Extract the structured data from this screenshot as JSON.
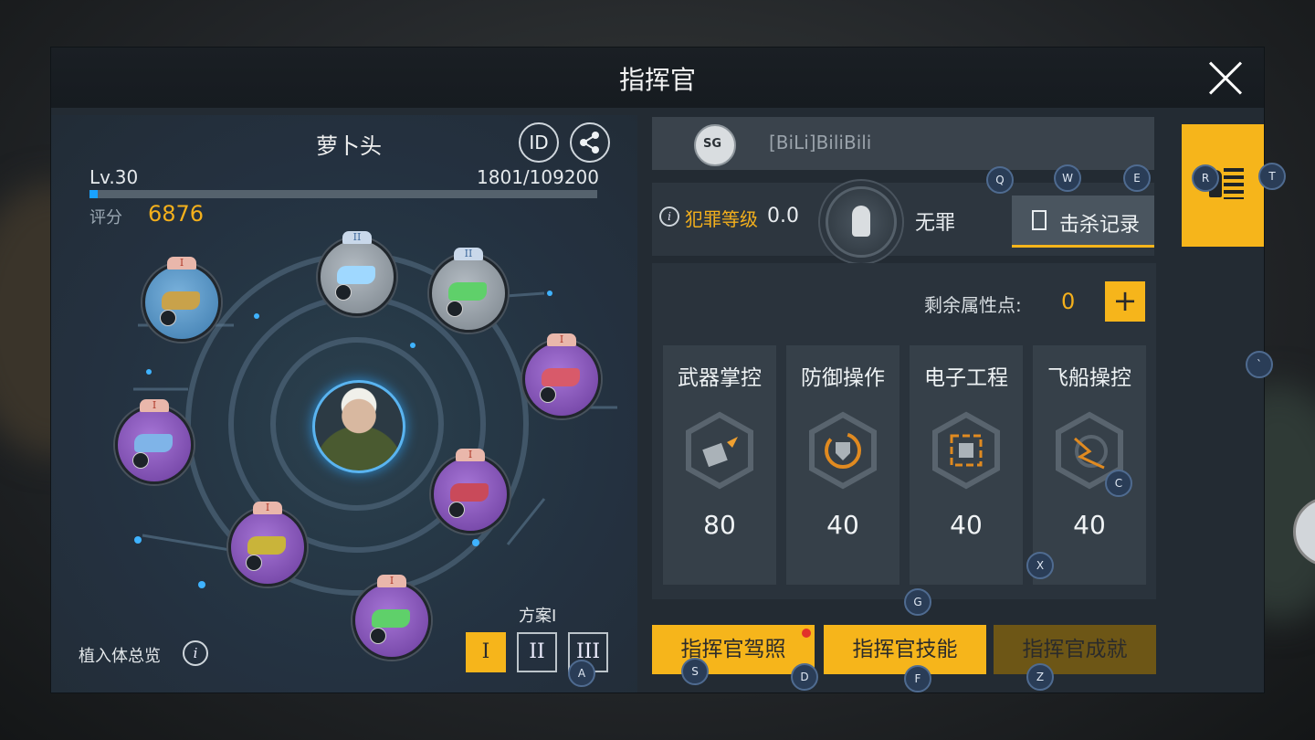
{
  "window": {
    "title": "指挥官"
  },
  "player": {
    "name": "萝卜头",
    "id_button": "ID",
    "level": "Lv.30",
    "exp_text": "1801/109200",
    "exp_ratio": 0.0165,
    "score_label": "评分",
    "score_value": "6876"
  },
  "implants": {
    "overview_label": "植入体总览",
    "info_glyph": "i",
    "slots": [
      {
        "tier": "I",
        "rarity": "blue",
        "item_color": "#c9a24a"
      },
      {
        "tier": "II",
        "rarity": "grey",
        "item_color": "#9fd8ff"
      },
      {
        "tier": "II",
        "rarity": "grey",
        "item_color": "#5fd06a"
      },
      {
        "tier": "I",
        "rarity": "purple",
        "item_color": "#d85a6a"
      },
      {
        "tier": "I",
        "rarity": "purple",
        "item_color": "#7fb4e8"
      },
      {
        "tier": "I",
        "rarity": "purple",
        "item_color": "#c94a5a"
      },
      {
        "tier": "I",
        "rarity": "purple",
        "item_color": "#c9b43a"
      },
      {
        "tier": "I",
        "rarity": "purple",
        "item_color": "#5fd06a"
      }
    ]
  },
  "plan": {
    "label": "方案I",
    "buttons": [
      "I",
      "II",
      "III"
    ],
    "active_index": 0
  },
  "guild": {
    "logo": "SG",
    "name": "[BiLi]BiliBili"
  },
  "crime": {
    "info_glyph": "i",
    "label": "犯罪等级",
    "value": "0.0",
    "status": "无罪",
    "kill_record_label": "击杀记录"
  },
  "attributes": {
    "remaining_label": "剩余属性点:",
    "remaining_value": "0",
    "plus_label": "+",
    "items": [
      {
        "name": "武器掌控",
        "value": "80",
        "icon": "weapon-icon"
      },
      {
        "name": "防御操作",
        "value": "40",
        "icon": "shield-icon"
      },
      {
        "name": "电子工程",
        "value": "40",
        "icon": "chip-icon"
      },
      {
        "name": "飞船操控",
        "value": "40",
        "icon": "ship-icon"
      }
    ]
  },
  "bottom_buttons": {
    "license": "指挥官驾照",
    "skills": "指挥官技能",
    "achievements": "指挥官成就"
  },
  "hotkeys": {
    "q": "Q",
    "w": "W",
    "e": "E",
    "r": "R",
    "t": "T",
    "backtick": "`",
    "c": "C",
    "x": "X",
    "g": "G",
    "a": "A",
    "s": "S",
    "d": "D",
    "f": "F",
    "z": "Z"
  },
  "colors": {
    "accent": "#f6b51b",
    "score": "#f4b01c",
    "exp_fill": "#19a2ff",
    "panel": "#232b33"
  }
}
